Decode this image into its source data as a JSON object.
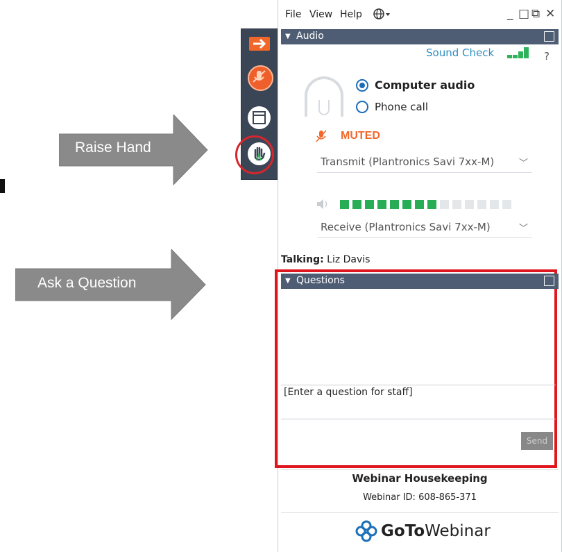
{
  "annotations": {
    "raise_hand_label": "Raise Hand",
    "ask_question_label": "Ask a Question",
    "arrow_color": "#8a8a8a",
    "highlight_color": "#e0161e"
  },
  "menubar": {
    "file": "File",
    "view": "View",
    "help": "Help",
    "globe_icon": "globe-icon",
    "minimize": "_",
    "maximize": "□",
    "popout": "⧉",
    "close": "✕"
  },
  "sidebar": {
    "items": [
      {
        "name": "exit-arrow-icon",
        "color": "#f1672a"
      },
      {
        "name": "mic-muted-icon",
        "color": "#ee5f2c"
      },
      {
        "name": "panel-window-icon",
        "color": "#ffffff"
      },
      {
        "name": "raise-hand-icon",
        "color": "#ffffff"
      }
    ]
  },
  "audio": {
    "section_title": "Audio",
    "sound_check": "Sound Check",
    "help_mark": "?",
    "computer_audio": "Computer audio",
    "phone_call": "Phone call",
    "selected": "Computer audio",
    "muted": "MUTED",
    "transmit": "Transmit (Plantronics Savi 7xx-M)",
    "receive": "Receive (Plantronics Savi 7xx-M)",
    "speaker_level_segments_on": 8,
    "talking_label": "Talking:",
    "talking_name": "Liz Davis"
  },
  "questions": {
    "section_title": "Questions",
    "input_placeholder": "[Enter a question for staff]",
    "send_label": "Send"
  },
  "footer": {
    "title": "Webinar Housekeeping",
    "webinar_id": "Webinar ID: 608-865-371",
    "brand_bold": "GoTo",
    "brand_light": "Webinar"
  }
}
